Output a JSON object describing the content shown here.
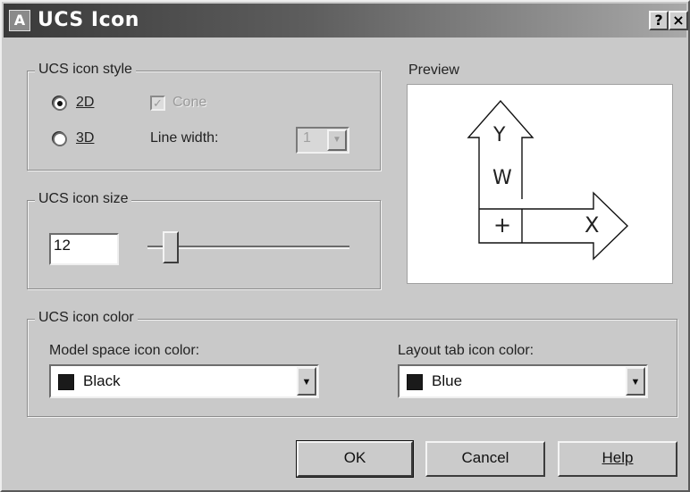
{
  "window": {
    "title": "UCS Icon",
    "help_button": "?",
    "close_button": "×"
  },
  "style_group": {
    "legend": "UCS icon style",
    "radio_2d": {
      "label": "2D",
      "selected": true
    },
    "radio_3d": {
      "label": "3D",
      "selected": false
    },
    "cone": {
      "label": "Cone",
      "checked": true,
      "enabled": false
    },
    "line_width": {
      "label": "Line width:",
      "value": "1",
      "enabled": false
    }
  },
  "size_group": {
    "legend": "UCS icon size",
    "value": "12",
    "slider_fraction": 0.08
  },
  "preview": {
    "legend": "Preview",
    "y_label": "Y",
    "x_label": "X",
    "w_label": "W",
    "plus_label": "+"
  },
  "color_group": {
    "legend": "UCS icon color",
    "model_space": {
      "label": "Model space icon color:",
      "value": "Black",
      "swatch": "#1a1a1a"
    },
    "layout_tab": {
      "label": "Layout tab icon color:",
      "value": "Blue",
      "swatch": "#1a1a1a"
    }
  },
  "buttons": {
    "ok": "OK",
    "cancel": "Cancel",
    "help": "Help"
  }
}
